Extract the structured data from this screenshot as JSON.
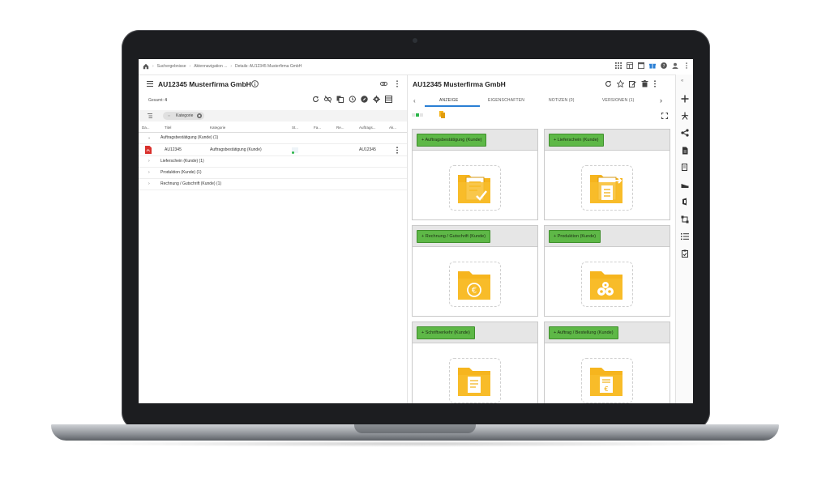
{
  "breadcrumb": {
    "home_icon": "home-icon",
    "items": [
      "Suchergebnisse",
      "Aktennavigation ...",
      "Details: AU12345 Musterfirma GmbH"
    ]
  },
  "topbar_icons": [
    "apps-icon",
    "layout-icon",
    "window-icon",
    "gift-icon",
    "help-icon",
    "user-icon",
    "more-vert-icon"
  ],
  "left": {
    "title": "AU12345 Musterfirma GmbH",
    "total_label": "Gesamt:",
    "total_value": "4",
    "filter_chip": "Kategorie",
    "columns": [
      "Da...",
      "Titel",
      "Kategorie",
      "St...",
      "Fa...",
      "Re...",
      "Auftrags...",
      "Ak..."
    ],
    "groups": [
      {
        "label": "Auftragsbestätigung (Kunde) (1)",
        "expanded": true
      },
      {
        "label": "Lieferschein (Kunde) (1)",
        "expanded": false
      },
      {
        "label": "Produktion (Kunde) (1)",
        "expanded": false
      },
      {
        "label": "Rechnung / Gutschrift (Kunde) (1)",
        "expanded": false
      }
    ],
    "document_row": {
      "title": "AU12345",
      "category": "Auftragsbestätigung (Kunde)",
      "order": "AU12345"
    }
  },
  "right": {
    "title": "AU12345 Musterfirma GmbH",
    "tabs": [
      "ANZEIGE",
      "EIGENSCHAFTEN",
      "NOTIZEN (0)",
      "VERSIONEN (1)"
    ],
    "active_tab": "ANZEIGE",
    "cards": [
      {
        "label": "Auftragsbestätigung (Kunde)",
        "icon": "folder-check-icon"
      },
      {
        "label": "Lieferschein (Kunde)",
        "icon": "folder-delivery-icon"
      },
      {
        "label": "Rechnung / Gutschrift (Kunde)",
        "icon": "folder-euro-icon"
      },
      {
        "label": "Produktion (Kunde)",
        "icon": "folder-gears-icon"
      },
      {
        "label": "Schriftverkehr (Kunde)",
        "icon": "folder-letter-icon"
      },
      {
        "label": "Auftrag / Bestellung (Kunde)",
        "icon": "folder-invoice-icon"
      }
    ]
  },
  "colors": {
    "green_button": "#5eb847",
    "folder_yellow": "#f6b51e",
    "accent_blue": "#2a7fd4"
  }
}
